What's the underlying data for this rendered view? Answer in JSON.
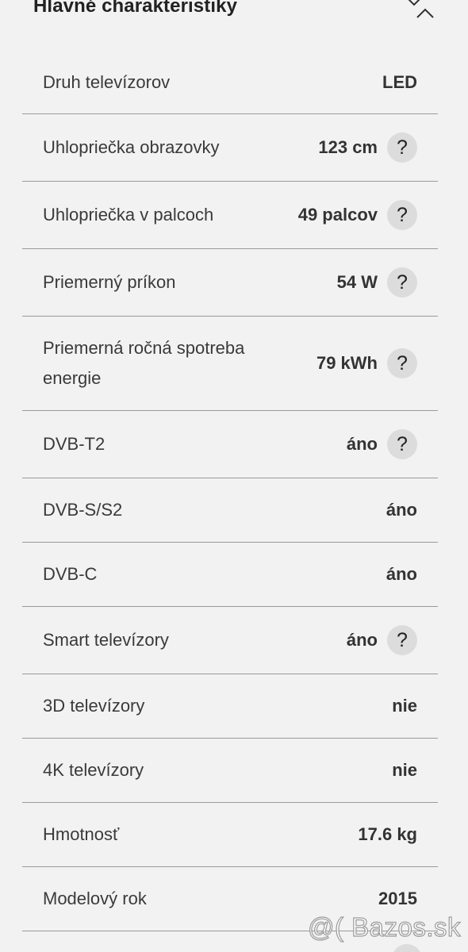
{
  "header": {
    "title": "Hlavné charakteristiky",
    "collapse_icon": "chevron-up-icon"
  },
  "help_glyph": "?",
  "rows": [
    {
      "label": "Druh televízorov",
      "value": "LED",
      "help": false
    },
    {
      "label": "Uhlopriečka obrazovky",
      "value": "123 cm",
      "help": true
    },
    {
      "label": "Uhlopriečka v palcoch",
      "value": "49 palcov",
      "help": true
    },
    {
      "label": "Priemerný príkon",
      "value": "54 W",
      "help": true
    },
    {
      "label": "Priemerná ročná spotreba energie",
      "value": "79 kWh",
      "help": true
    },
    {
      "label": "DVB-T2",
      "value": "áno",
      "help": true
    },
    {
      "label": "DVB-S/S2",
      "value": "áno",
      "help": false
    },
    {
      "label": "DVB-C",
      "value": "áno",
      "help": false
    },
    {
      "label": "Smart televízory",
      "value": "áno",
      "help": true
    },
    {
      "label": "3D televízory",
      "value": "nie",
      "help": false
    },
    {
      "label": "4K televízory",
      "value": "nie",
      "help": false
    },
    {
      "label": "Hmotnosť",
      "value": "17.6 kg",
      "help": false
    },
    {
      "label": "Modelový rok",
      "value": "2015",
      "help": false
    }
  ],
  "watermark": "@( Bazos.sk",
  "colors": {
    "background": "#f2f2f2",
    "divider": "#9a9a9a",
    "help_circle": "#dcdcdc"
  }
}
